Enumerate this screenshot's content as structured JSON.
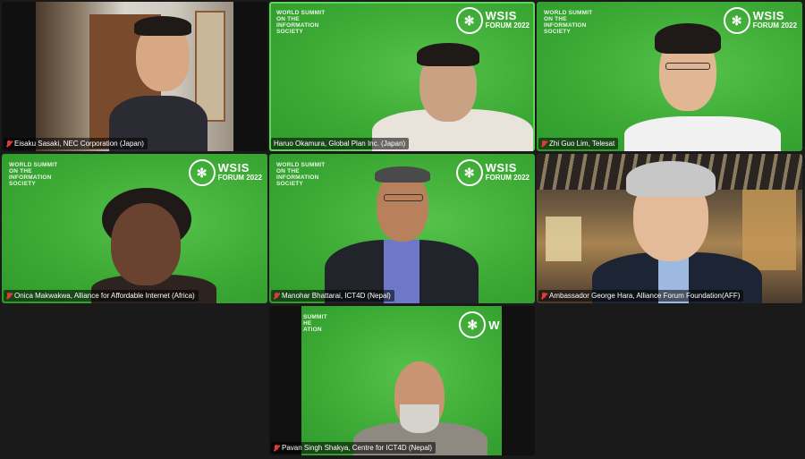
{
  "meeting": {
    "participants": [
      {
        "name": "Eisaku Sasaki, NEC Corporation (Japan)"
      },
      {
        "name": "Haruo Okamura, Global Plan Inc. (Japan)"
      },
      {
        "name": "Zhi Guo Lim, Telesat"
      },
      {
        "name": "Onica Makwakwa, Alliance for Affordable Internet (Africa)"
      },
      {
        "name": "Manohar Bhattarai, ICT4D (Nepal)"
      },
      {
        "name": "Ambassador George Hara, Alliance Forum Foundation(AFF)"
      },
      {
        "name": "Pavan Singh Shakya, Centre for ICT4D (Nepal)"
      }
    ],
    "background": {
      "summit_text": "WORLD SUMMIT\nON THE\nINFORMATION\nSOCIETY",
      "logo_title": "WSIS",
      "logo_subtitle": "FORUM 2022",
      "logo_mark": "✻",
      "partial_summit_text": "SUMMIT\nHE\nATION",
      "partial_logo_title": "W"
    },
    "icons": {
      "muted": "mic-muted-icon"
    },
    "colors": {
      "green_bg": "#3caa35",
      "muted_red": "#e23a3a",
      "grid_bg": "#1a1a1a"
    }
  }
}
